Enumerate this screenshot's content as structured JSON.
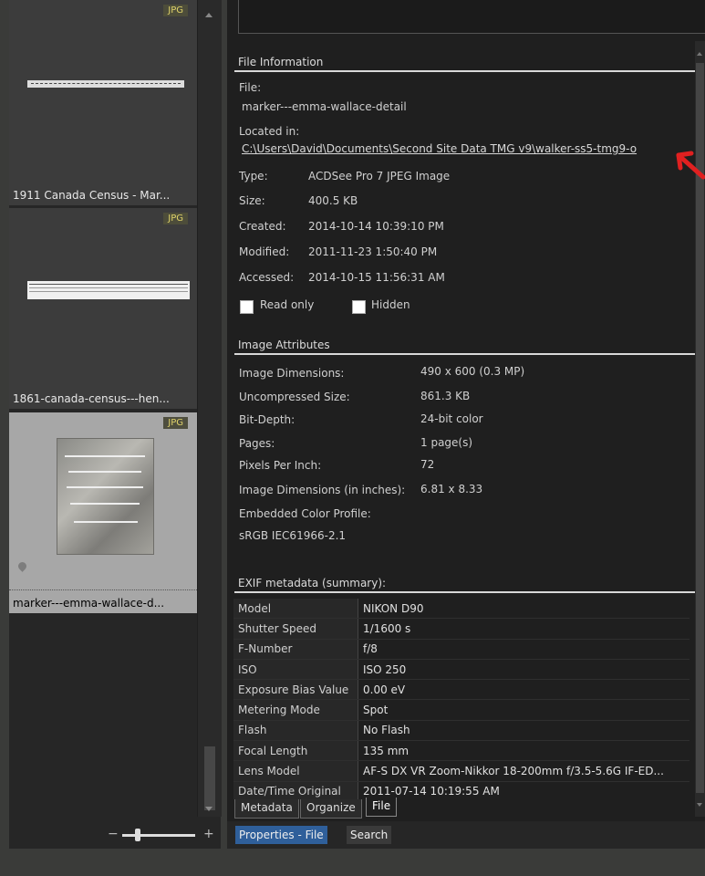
{
  "thumbnails": [
    {
      "badge": "JPG",
      "caption": "1911 Canada Census - Mar..."
    },
    {
      "badge": "JPG",
      "caption": "1861-canada-census---hen..."
    },
    {
      "badge": "JPG",
      "caption": "marker---emma-wallace-d..."
    }
  ],
  "file_info": {
    "section_title": "File Information",
    "file_label": "File:",
    "file_value": "marker---emma-wallace-detail",
    "located_label": "Located in:",
    "located_value": "C:\\Users\\David\\Documents\\Second Site Data TMG v9\\walker-ss5-tmg9-o",
    "type_label": "Type:",
    "type_value": "ACDSee Pro 7 JPEG Image",
    "size_label": "Size:",
    "size_value": "400.5 KB",
    "created_label": "Created:",
    "created_value": "2014-10-14 10:39:10 PM",
    "modified_label": "Modified:",
    "modified_value": "2011-11-23 1:50:40 PM",
    "accessed_label": "Accessed:",
    "accessed_value": "2014-10-15 11:56:31 AM",
    "readonly_label": "Read only",
    "hidden_label": "Hidden"
  },
  "image_attrs": {
    "section_title": "Image Attributes",
    "rows": [
      {
        "k": "Image Dimensions:",
        "v": "490 x 600 (0.3 MP)"
      },
      {
        "k": "Uncompressed Size:",
        "v": "861.3 KB"
      },
      {
        "k": "Bit-Depth:",
        "v": "24-bit color"
      },
      {
        "k": "Pages:",
        "v": "1 page(s)"
      },
      {
        "k": "Pixels Per Inch:",
        "v": "72"
      },
      {
        "k": "Image Dimensions (in inches):",
        "v": "6.81 x 8.33"
      }
    ],
    "profile_label": "Embedded Color Profile:",
    "profile_value": "sRGB IEC61966-2.1"
  },
  "exif": {
    "section_title": "EXIF metadata (summary):",
    "rows": [
      {
        "k": "Model",
        "v": "NIKON D90"
      },
      {
        "k": "Shutter Speed",
        "v": "1/1600 s"
      },
      {
        "k": "F-Number",
        "v": "f/8"
      },
      {
        "k": "ISO",
        "v": "ISO 250"
      },
      {
        "k": "Exposure Bias Value",
        "v": "0.00 eV"
      },
      {
        "k": "Metering Mode",
        "v": "Spot"
      },
      {
        "k": "Flash",
        "v": "No Flash"
      },
      {
        "k": "Focal Length",
        "v": "135 mm"
      },
      {
        "k": "Lens Model",
        "v": "AF-S DX VR Zoom-Nikkor 18-200mm f/3.5-5.6G IF-ED..."
      },
      {
        "k": "Date/Time Original",
        "v": "2011-07-14 10:19:55 AM"
      }
    ]
  },
  "tabs": [
    "Metadata",
    "Organize",
    "File"
  ],
  "bottom": {
    "properties": "Properties - File",
    "search": "Search"
  },
  "colors": {
    "accent": "#2f5f9a",
    "arrow": "#e02020"
  }
}
